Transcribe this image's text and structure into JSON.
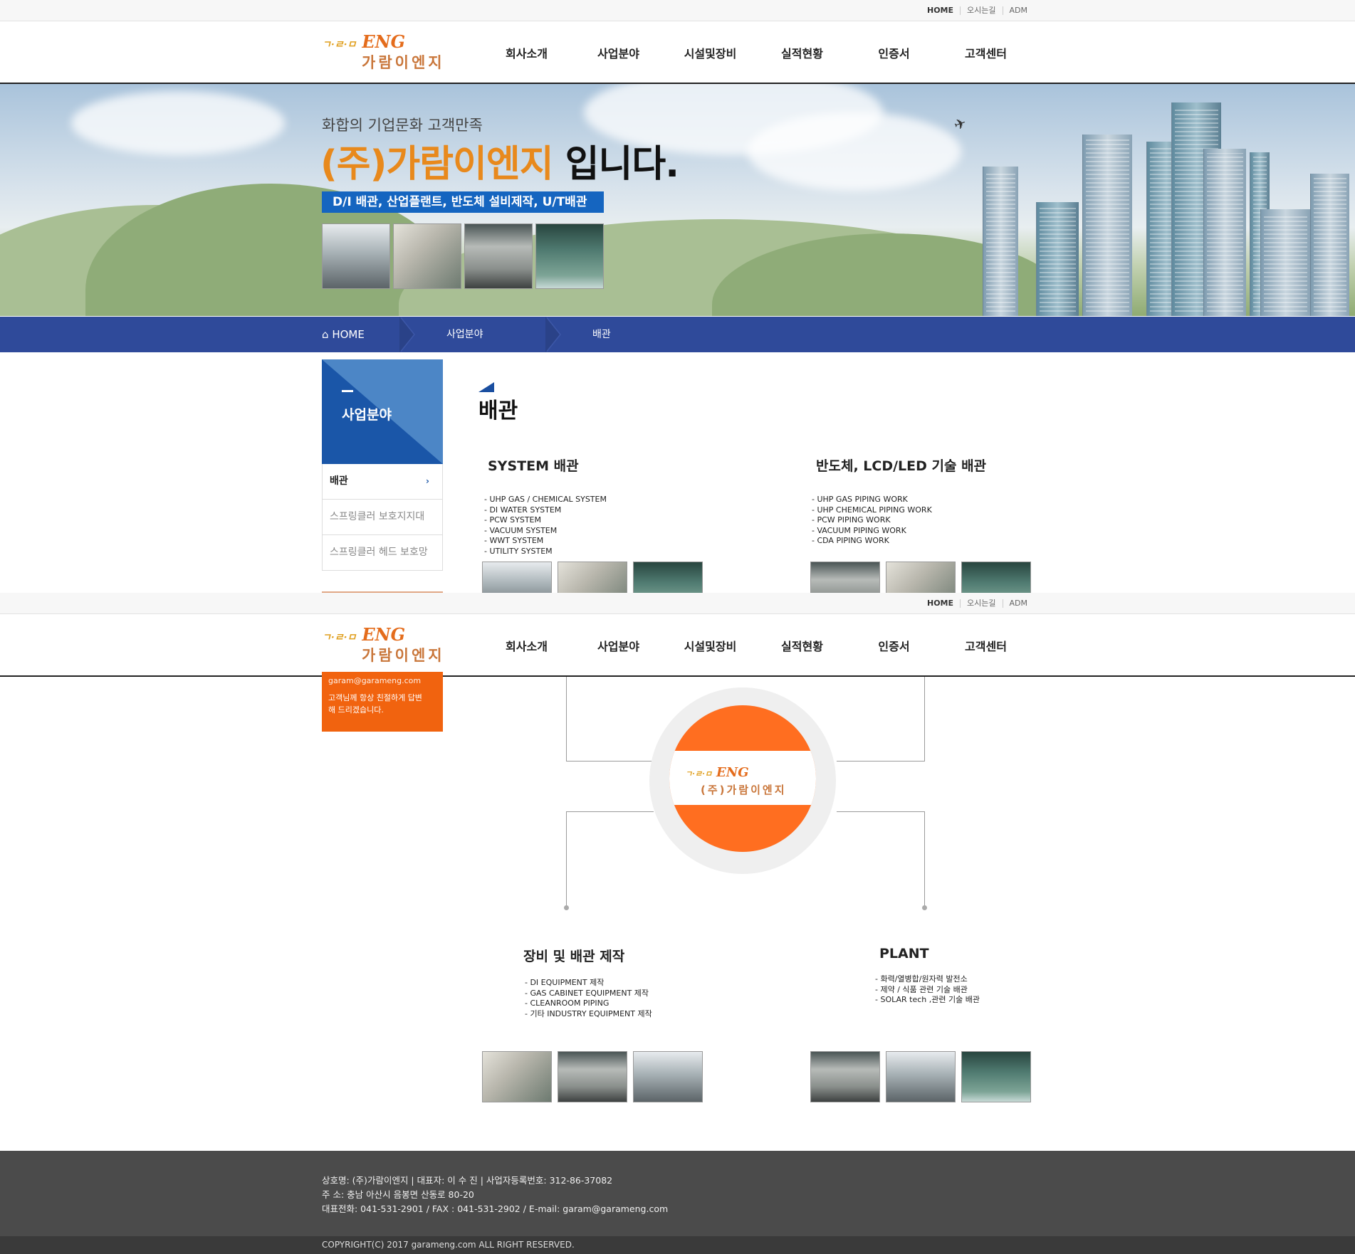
{
  "util": {
    "items": [
      "HOME",
      "오시는길",
      "ADM"
    ]
  },
  "logo": {
    "small": "ㄱ·ㄹ·ㅁ",
    "eng": "ENG",
    "ko": "가람이엔지",
    "core_ko": "(주)가람이엔지"
  },
  "nav": [
    "회사소개",
    "사업분야",
    "시설및장비",
    "실적현황",
    "인증서",
    "고객센터"
  ],
  "hero": {
    "subtitle": "화합의 기업문화 고객만족",
    "title_highlight": "(주)가람이엔지",
    "title_rest": " 입니다.",
    "tagline": "D/I 배관, 산업플랜트, 반도체 설비제작, U/T배관"
  },
  "breadcrumb": {
    "home": "HOME",
    "level1": "사업분야",
    "level2": "배관"
  },
  "sidebar": {
    "title": "사업분야",
    "items": [
      {
        "label": "배관",
        "active": true,
        "arrow": "›"
      },
      {
        "label": "스프링클러 보호지지대",
        "active": false
      },
      {
        "label": "스프링클러 헤드 보호망",
        "active": false
      }
    ]
  },
  "contact_box": {
    "email": "garam@garameng.com",
    "message_1": "고객님께 항상 친절하게 답변",
    "message_2": "해 드리겠습니다."
  },
  "page_title": "배관",
  "sections": [
    {
      "title": "SYSTEM 배관",
      "items": [
        "- UHP GAS / CHEMICAL SYSTEM",
        "- DI WATER SYSTEM",
        "- PCW SYSTEM",
        "- VACUUM SYSTEM",
        "- WWT SYSTEM",
        "- UTILITY SYSTEM"
      ]
    },
    {
      "title": "반도체, LCD/LED 기술 배관",
      "items": [
        "- UHP GAS PIPING WORK",
        "- UHP CHEMICAL PIPING WORK",
        "- PCW PIPING WORK",
        "- VACUUM PIPING WORK",
        "- CDA PIPING WORK"
      ]
    },
    {
      "title": "장비 및 배관 제작",
      "items": [
        "- DI EQUIPMENT 제작",
        "- GAS CABINET EQUIPMENT 제작",
        "- CLEANROOM PIPING",
        "- 기타 INDUSTRY EQUIPMENT 제작"
      ]
    },
    {
      "title": "PLANT",
      "items": [
        "- 화력/열병합/원자력 발전소",
        "- 제약 / 식품  관련 기술 배관",
        "- SOLAR tech ,관련 기술 배관"
      ]
    }
  ],
  "footer": {
    "line1": "상호명: (주)가람이엔지   |  대표자: 이 수 진   |  사업자등록번호: 312-86-37082",
    "line2": "주    소: 충남 아산시 음봉면 산동로 80-20",
    "line3": "대표전화: 041-531-2901 / FAX : 041-531-2902 / E-mail: garam@garameng.com",
    "copyright": "COPYRIGHT(C) 2017 garameng.com ALL RIGHT RESERVED."
  },
  "colors": {
    "accent_blue": "#2f4a9a",
    "accent_orange": "#f1630f",
    "title_orange": "#e8891c",
    "tag_blue": "#1565c0"
  }
}
